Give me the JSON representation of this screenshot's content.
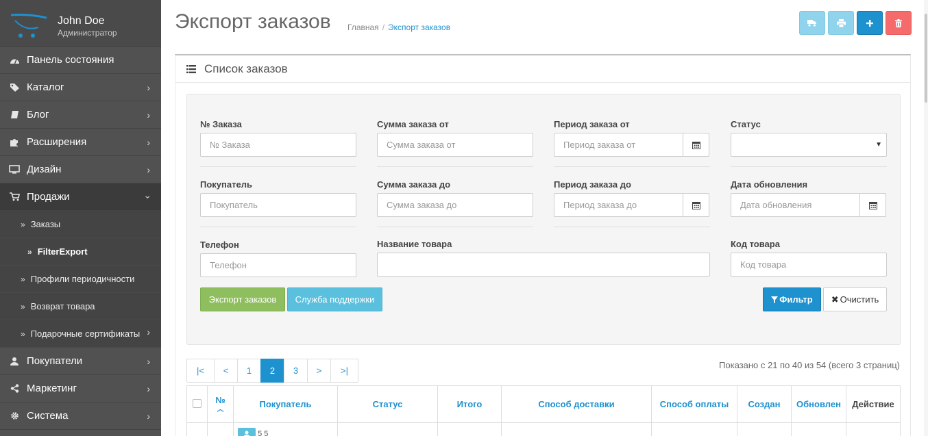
{
  "user": {
    "name": "John Doe",
    "role": "Администратор"
  },
  "nav": [
    {
      "label": "Панель состояния",
      "icon": "dashboard-icon",
      "has_children": false
    },
    {
      "label": "Каталог",
      "icon": "tags-icon",
      "has_children": true
    },
    {
      "label": "Блог",
      "icon": "book-icon",
      "has_children": true
    },
    {
      "label": "Расширения",
      "icon": "puzzle-icon",
      "has_children": true
    },
    {
      "label": "Дизайн",
      "icon": "desktop-icon",
      "has_children": true
    },
    {
      "label": "Продажи",
      "icon": "cart-icon",
      "has_children": true,
      "expanded": true
    }
  ],
  "sales_sub": [
    {
      "label": "Заказы"
    },
    {
      "label": "FilterExport",
      "current": true
    },
    {
      "label": "Профили периодичности"
    },
    {
      "label": "Возврат товара"
    },
    {
      "label": "Подарочные сертификаты",
      "has_children": true
    }
  ],
  "nav_bottom": [
    {
      "label": "Покупатели",
      "icon": "user-icon"
    },
    {
      "label": "Маркетинг",
      "icon": "share-icon"
    },
    {
      "label": "Система",
      "icon": "gear-icon"
    }
  ],
  "header": {
    "title": "Экспорт заказов",
    "breadcrumb": [
      "Главная",
      "Экспорт заказов"
    ]
  },
  "toolbar": {
    "buttons": [
      {
        "name": "shipping-button",
        "icon": "truck-icon",
        "color": "#8fd3ec"
      },
      {
        "name": "print-button",
        "icon": "print-icon",
        "color": "#8fd3ec"
      },
      {
        "name": "add-button",
        "icon": "plus-icon",
        "color": "#1e91cf"
      },
      {
        "name": "delete-button",
        "icon": "trash-icon",
        "color": "#f56b6b"
      }
    ]
  },
  "panel": {
    "title": "Список заказов"
  },
  "filters": {
    "order_id": {
      "label": "№ Заказа",
      "placeholder": "№ Заказа"
    },
    "total_from": {
      "label": "Сумма заказа от",
      "placeholder": "Сумма заказа от"
    },
    "date_from": {
      "label": "Период заказа от",
      "placeholder": "Период заказа от"
    },
    "status": {
      "label": "Статус",
      "value": ""
    },
    "customer": {
      "label": "Покупатель",
      "placeholder": "Покупатель"
    },
    "total_to": {
      "label": "Сумма заказа до",
      "placeholder": "Сумма заказа до"
    },
    "date_to": {
      "label": "Период заказа до",
      "placeholder": "Период заказа до"
    },
    "date_modified": {
      "label": "Дата обновления",
      "placeholder": "Дата обновления"
    },
    "phone": {
      "label": "Телефон",
      "placeholder": "Телефон"
    },
    "product_name": {
      "label": "Название товара",
      "placeholder": ""
    },
    "product_code": {
      "label": "Код товара",
      "placeholder": "Код товара"
    }
  },
  "actions": {
    "export": "Экспорт заказов",
    "support": "Служба поддержки",
    "filter": "Фильтр",
    "clear": "Очистить"
  },
  "pagination": {
    "pages": [
      "|<",
      "<",
      "1",
      "2",
      "3",
      ">",
      ">|"
    ],
    "active": "2",
    "info": "Показано с 21 по 40 из 54 (всего 3 страниц)"
  },
  "table": {
    "columns": [
      "№",
      "Покупатель",
      "Статус",
      "Итого",
      "Способ доставки",
      "Способ оплаты",
      "Создан",
      "Обновлен",
      "Действие"
    ],
    "first_row_customer": "5 5"
  },
  "colors": {
    "sidebar": "#515151",
    "accent": "#1e91cf",
    "export_btn": "#8fbe5e",
    "support_btn": "#5bc0de",
    "danger": "#f56b6b"
  }
}
